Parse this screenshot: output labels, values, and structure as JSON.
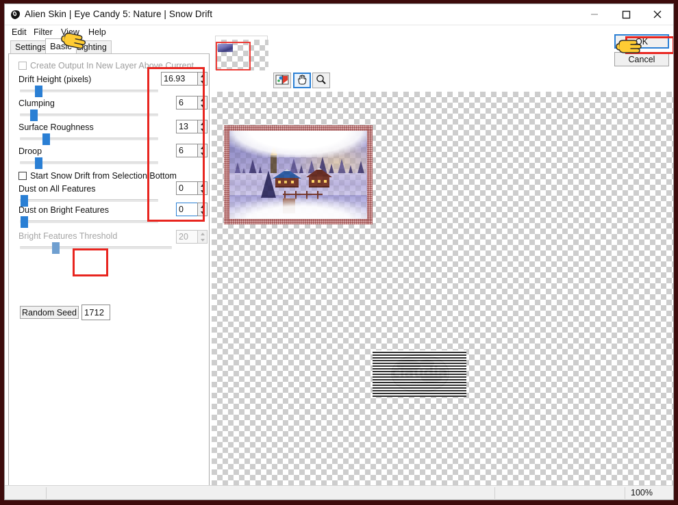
{
  "window": {
    "title": "Alien Skin | Eye Candy 5: Nature | Snow Drift",
    "app_icon": "alien-skin-icon",
    "minimize_label": "—",
    "maximize_label": "□",
    "close_label": "✕"
  },
  "menu": {
    "items": [
      {
        "label": "Edit"
      },
      {
        "label": "Filter"
      },
      {
        "label": "View"
      },
      {
        "label": "Help"
      }
    ]
  },
  "tabs": [
    {
      "label": "Settings",
      "active": false
    },
    {
      "label": "Basic",
      "active": true
    },
    {
      "label": "Lighting",
      "active": false
    }
  ],
  "panel": {
    "checkbox_output": {
      "label": "Create Output In New Layer Above Current",
      "checked": false,
      "enabled": false
    },
    "checkbox_start_bottom": {
      "label": "Start Snow Drift from Selection Bottom",
      "checked": false,
      "enabled": true
    },
    "sliders": [
      {
        "label": "Drift Height (pixels)",
        "value": "16.93",
        "enabled": true,
        "thumb_pct": 15
      },
      {
        "label": "Clumping",
        "value": "6",
        "enabled": true,
        "thumb_pct": 10
      },
      {
        "label": "Surface Roughness",
        "value": "13",
        "enabled": true,
        "thumb_pct": 19
      },
      {
        "label": "Droop",
        "value": "6",
        "enabled": true,
        "thumb_pct": 14
      },
      {
        "label": "Dust on All Features",
        "value": "0",
        "enabled": true,
        "thumb_pct": 2
      },
      {
        "label": "Dust on Bright Features",
        "value": "0",
        "enabled": true,
        "thumb_pct": 2
      },
      {
        "label": "Bright Features Threshold",
        "value": "20",
        "enabled": false,
        "thumb_pct": 21
      }
    ],
    "random_seed": {
      "button_label": "Random Seed",
      "value": "1712"
    }
  },
  "preview": {
    "navigator_name": "navigator-thumbnail",
    "tools": [
      {
        "name": "compare-before-after-icon",
        "selected": false
      },
      {
        "name": "hand-pan-icon",
        "selected": true
      },
      {
        "name": "zoom-magnifier-icon",
        "selected": false
      }
    ],
    "artwork_alt": "winter village snow scene with snow drift",
    "watermark": {
      "word": "claudia",
      "sub": "creations"
    }
  },
  "actions": {
    "ok_label": "OK",
    "cancel_label": "Cancel"
  },
  "status": {
    "zoom": "100%"
  },
  "colors": {
    "accent": "#2a7fd4",
    "annotation": "#e8251f",
    "outer_frame": "#3d0c0c",
    "cursor": "#ffcc33"
  }
}
